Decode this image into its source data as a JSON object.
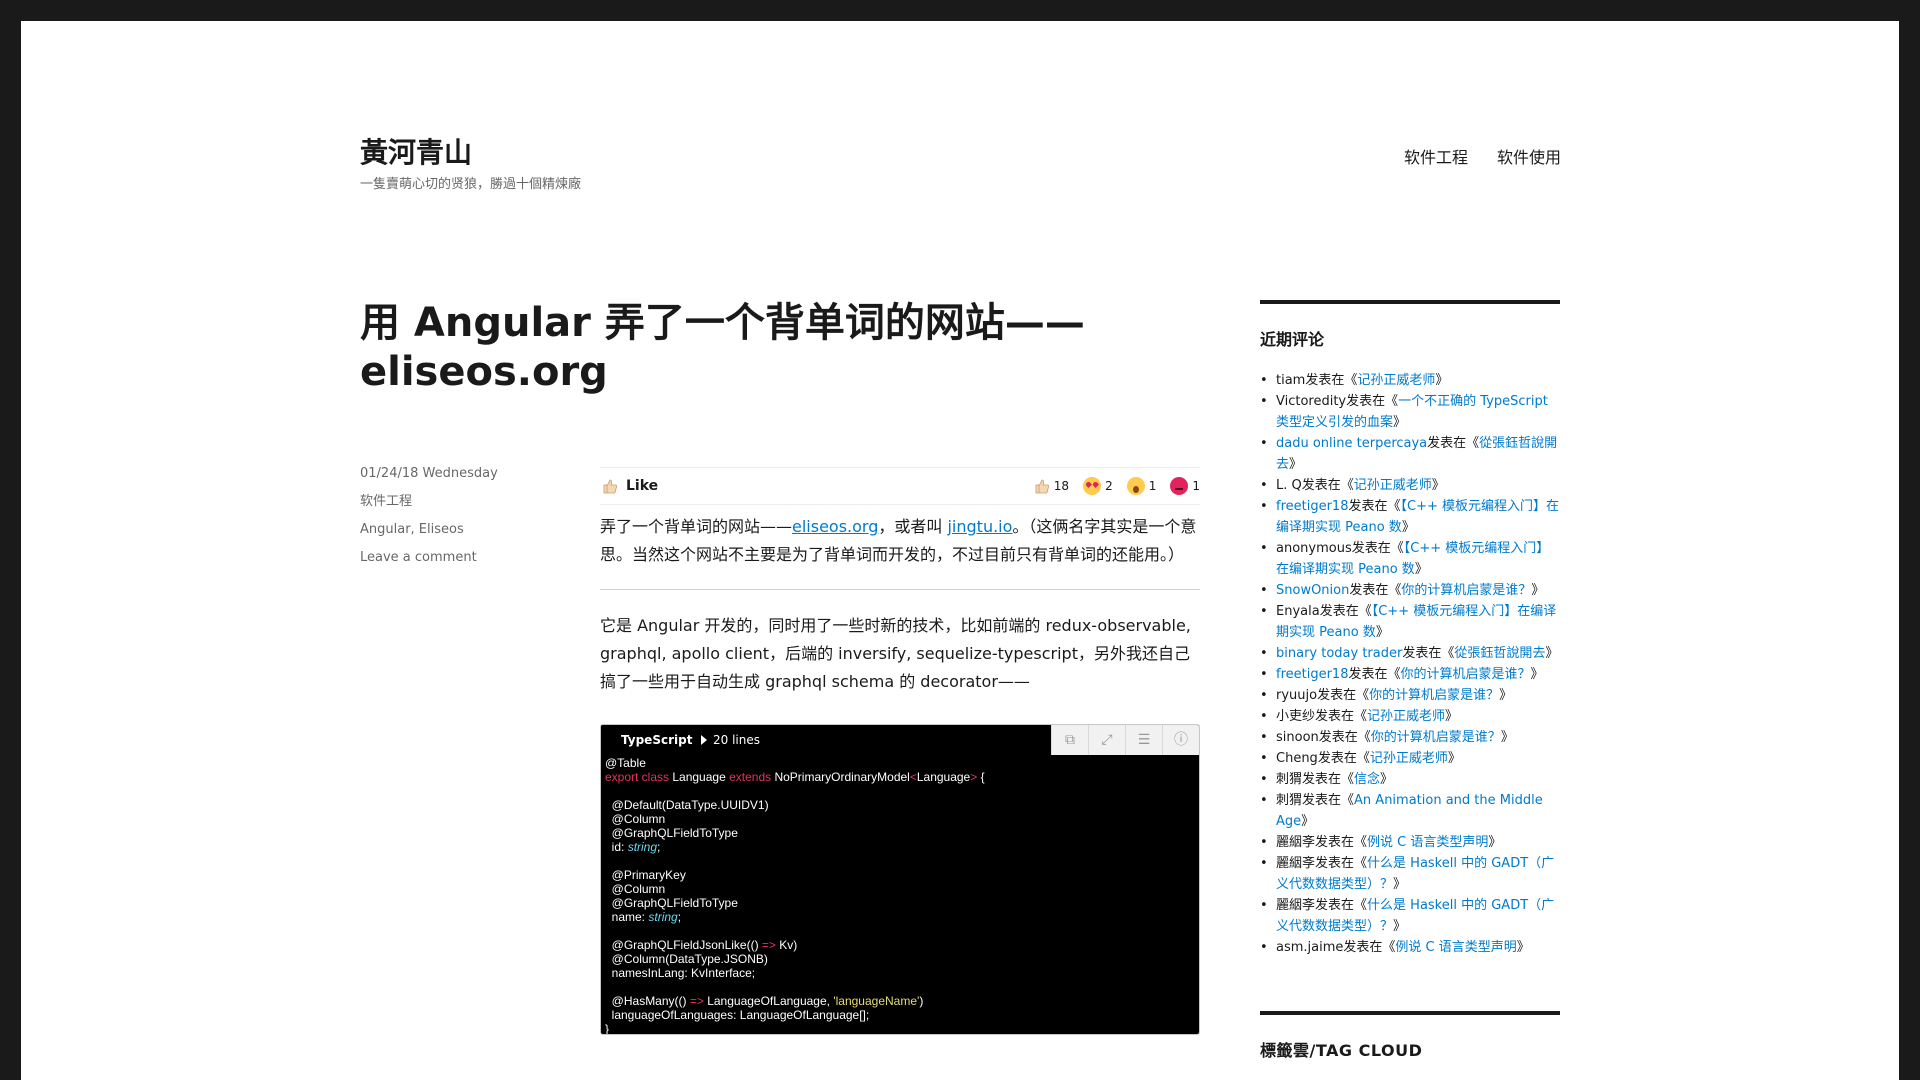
{
  "site": {
    "title": "黃河青山",
    "description": "一隻賣萌心切的贤狼，勝過十個精煉廠"
  },
  "nav": [
    {
      "label": "软件工程"
    },
    {
      "label": "软件使用"
    }
  ],
  "post": {
    "title": "用 Angular 弄了一个背单词的网站——eliseos.org",
    "date": "01/24/18 Wednesday",
    "category": "软件工程",
    "tags": "Angular, Eliseos",
    "comment_link": "Leave a comment",
    "like_label": "Like",
    "reactions": {
      "like": "18",
      "love": "2",
      "wow": "1",
      "angry": "1"
    },
    "para1": {
      "pre": "弄了一个背单词的网站——",
      "link1": "eliseos.org",
      "mid": "，或者叫 ",
      "link2": "jingtu.io",
      "post": "。（这俩名字其实是一个意思。当然这个网站不主要是为了背单词而开发的，不过目前只有背单词的还能用。）"
    },
    "para2": "它是 Angular 开发的，同时用了一些时新的技术，比如前端的 redux-observable, graphql, apollo client，后端的 inversify, sequelize-typescript，另外我还自己搞了一些用于自动生成 graphql schema 的 decorator——",
    "code": {
      "language": "TypeScript",
      "lines_label": "20 lines"
    }
  },
  "sidebar": {
    "recent_comments_title": "近期评论",
    "comments": [
      {
        "author": "tiam",
        "link_author": false,
        "posted": "发表在《",
        "post": "记孙正威老师",
        "end": "》"
      },
      {
        "author": "Victoredity",
        "link_author": false,
        "posted": "发表在《",
        "post": "一个不正确的 TypeScript 类型定义引发的血案",
        "end": "》"
      },
      {
        "author": "dadu online terpercaya",
        "link_author": true,
        "posted": "发表在《",
        "post": "從張鈺哲說開去",
        "end": "》"
      },
      {
        "author": "L. Q",
        "link_author": false,
        "posted": "发表在《",
        "post": "记孙正威老师",
        "end": "》"
      },
      {
        "author": "freetiger18",
        "link_author": true,
        "posted": "发表在《",
        "post": "【C++ 模板元编程入门】在编译期实现 Peano 数",
        "end": "》"
      },
      {
        "author": "anonymous",
        "link_author": false,
        "posted": "发表在《",
        "post": "【C++ 模板元编程入门】在编译期实现 Peano 数",
        "end": "》"
      },
      {
        "author": "SnowOnion",
        "link_author": true,
        "posted": "发表在《",
        "post": "你的计算机启蒙是谁？",
        "end": "》"
      },
      {
        "author": "Enyala",
        "link_author": false,
        "posted": "发表在《",
        "post": "【C++ 模板元编程入门】在编译期实现 Peano 数",
        "end": "》"
      },
      {
        "author": "binary today trader",
        "link_author": true,
        "posted": "发表在《",
        "post": "從張鈺哲說開去",
        "end": "》"
      },
      {
        "author": "freetiger18",
        "link_author": true,
        "posted": "发表在《",
        "post": "你的计算机启蒙是谁？",
        "end": "》"
      },
      {
        "author": "ryuujo",
        "link_author": false,
        "posted": "发表在《",
        "post": "你的计算机启蒙是谁？",
        "end": "》"
      },
      {
        "author": "小吏纱",
        "link_author": false,
        "posted": "发表在《",
        "post": "记孙正威老师",
        "end": "》"
      },
      {
        "author": "sinoon",
        "link_author": false,
        "posted": "发表在《",
        "post": "你的计算机启蒙是谁？",
        "end": "》"
      },
      {
        "author": "Cheng",
        "link_author": false,
        "posted": "发表在《",
        "post": "记孙正威老师",
        "end": "》"
      },
      {
        "author": "刺猬",
        "link_author": false,
        "posted": "发表在《",
        "post": "信念",
        "end": "》"
      },
      {
        "author": "刺猬",
        "link_author": false,
        "posted": "发表在《",
        "post": "An Animation and the Middle Age",
        "end": "》"
      },
      {
        "author": "麗絪斈",
        "link_author": false,
        "posted": "发表在《",
        "post": "例说 C 语言类型声明",
        "end": "》"
      },
      {
        "author": "麗絪斈",
        "link_author": false,
        "posted": "发表在《",
        "post": "什么是 Haskell 中的 GADT（广义代数数据类型）？",
        "end": "》"
      },
      {
        "author": "麗絪斈",
        "link_author": false,
        "posted": "发表在《",
        "post": "什么是 Haskell 中的 GADT（广义代数数据类型）？",
        "end": "》"
      },
      {
        "author": "asm.jaime",
        "link_author": false,
        "posted": "发表在《",
        "post": "例说 C 语言类型声明",
        "end": "》"
      }
    ],
    "tag_cloud_title": "標籤雲/TAG CLOUD"
  },
  "colors": {
    "link": "#007acc",
    "text": "#1a1a1a",
    "meta": "#686868",
    "frame": "#1a1a1a"
  }
}
